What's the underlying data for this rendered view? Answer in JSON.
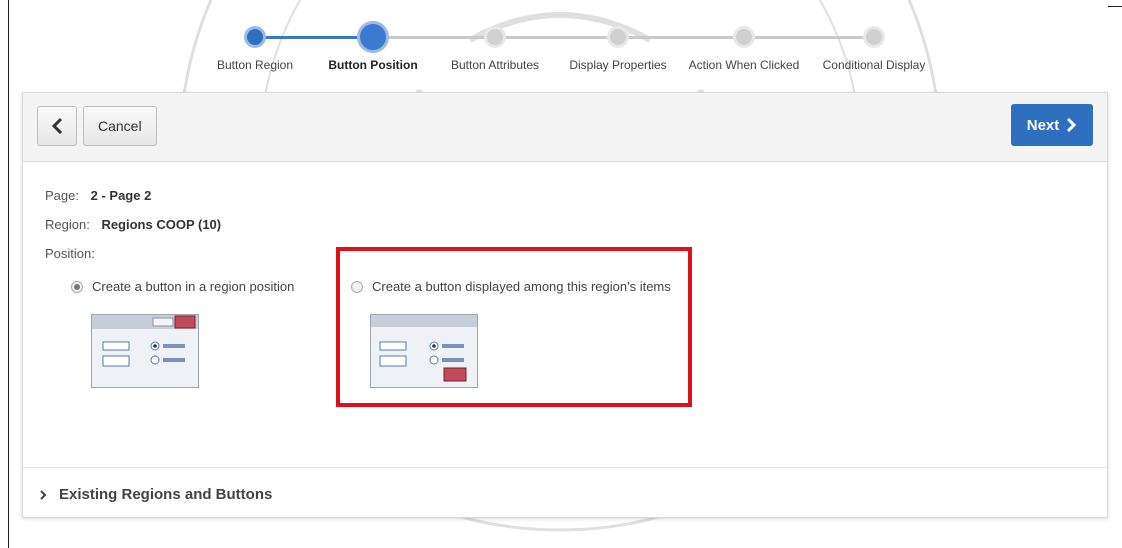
{
  "wizard": {
    "steps": [
      {
        "label": "Button Region",
        "state": "done"
      },
      {
        "label": "Button Position",
        "state": "current"
      },
      {
        "label": "Button Attributes",
        "state": "todo"
      },
      {
        "label": "Display Properties",
        "state": "todo"
      },
      {
        "label": "Action When Clicked",
        "state": "todo"
      },
      {
        "label": "Conditional Display",
        "state": "todo"
      }
    ]
  },
  "header": {
    "back_icon": "chevron-left-icon",
    "cancel_label": "Cancel",
    "next_label": "Next",
    "next_icon": "chevron-right-icon"
  },
  "info": {
    "page_label": "Page:",
    "page_value": "2 - Page 2",
    "region_label": "Region:",
    "region_value": "Regions COOP (10)",
    "position_label": "Position:"
  },
  "options": [
    {
      "label": "Create a button in a region position",
      "checked": true
    },
    {
      "label": "Create a button displayed among this region's items",
      "checked": false
    }
  ],
  "existing": {
    "label": "Existing Regions and Buttons",
    "icon": "chevron-right-icon"
  },
  "colors": {
    "accent": "#2f6fbf",
    "highlight": "#e0101a"
  }
}
